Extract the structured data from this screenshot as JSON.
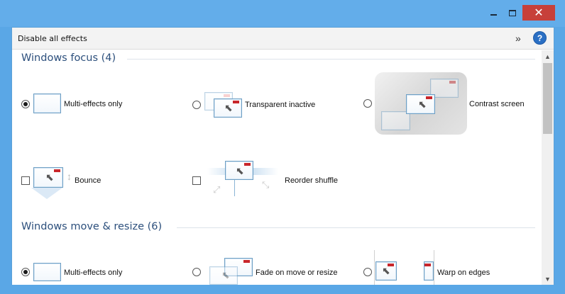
{
  "window": {
    "minimize_icon": "minimize-icon",
    "maximize_icon": "maximize-icon",
    "close_icon": "close-icon",
    "close_glyph": "✕",
    "accent": "#63adea",
    "close_color": "#c7403a"
  },
  "toolbar": {
    "label": "Disable all effects",
    "more_glyph": "»",
    "help_glyph": "?"
  },
  "sections": {
    "focus": {
      "title": "Windows focus (4)",
      "options": [
        {
          "label": "Multi-effects only",
          "control": "radio",
          "checked": true
        },
        {
          "label": "Transparent inactive",
          "control": "radio",
          "checked": false
        },
        {
          "label": "Contrast screen",
          "control": "radio",
          "checked": false
        },
        {
          "label": "Bounce",
          "control": "checkbox",
          "checked": false
        },
        {
          "label": "Reorder shuffle",
          "control": "checkbox",
          "checked": false
        }
      ]
    },
    "move": {
      "title": "Windows move & resize (6)",
      "options": [
        {
          "label": "Multi-effects only",
          "control": "radio",
          "checked": true
        },
        {
          "label": "Fade on move or resize",
          "control": "radio",
          "checked": false
        },
        {
          "label": "Warp on edges",
          "control": "radio",
          "checked": false
        }
      ]
    }
  },
  "scrollbar": {
    "up_glyph": "▲",
    "down_glyph": "▼"
  },
  "colors": {
    "section_title": "#2c4f7c",
    "thumb_border": "#6e9fc4",
    "thumb_marker": "#c8262b"
  }
}
